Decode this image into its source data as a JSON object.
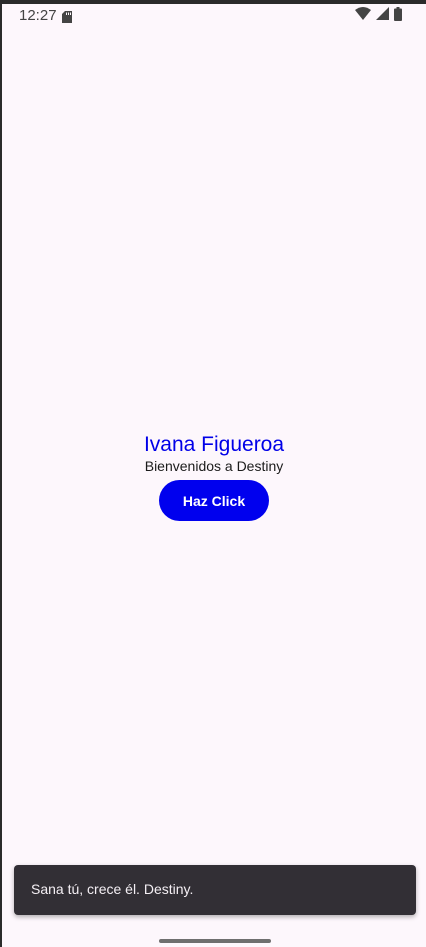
{
  "status_bar": {
    "time": "12:27",
    "icons": [
      "sd-card-icon",
      "wifi-icon",
      "signal-icon",
      "battery-icon"
    ]
  },
  "main": {
    "name": "Ivana Figueroa",
    "welcome": "Bienvenidos a Destiny",
    "button_label": "Haz Click"
  },
  "snackbar": {
    "message": "Sana tú, crece él. Destiny."
  },
  "colors": {
    "background": "#fdf7fc",
    "accent": "#0000ee",
    "name_text": "#0000e8",
    "snackbar_bg": "#322f35"
  }
}
